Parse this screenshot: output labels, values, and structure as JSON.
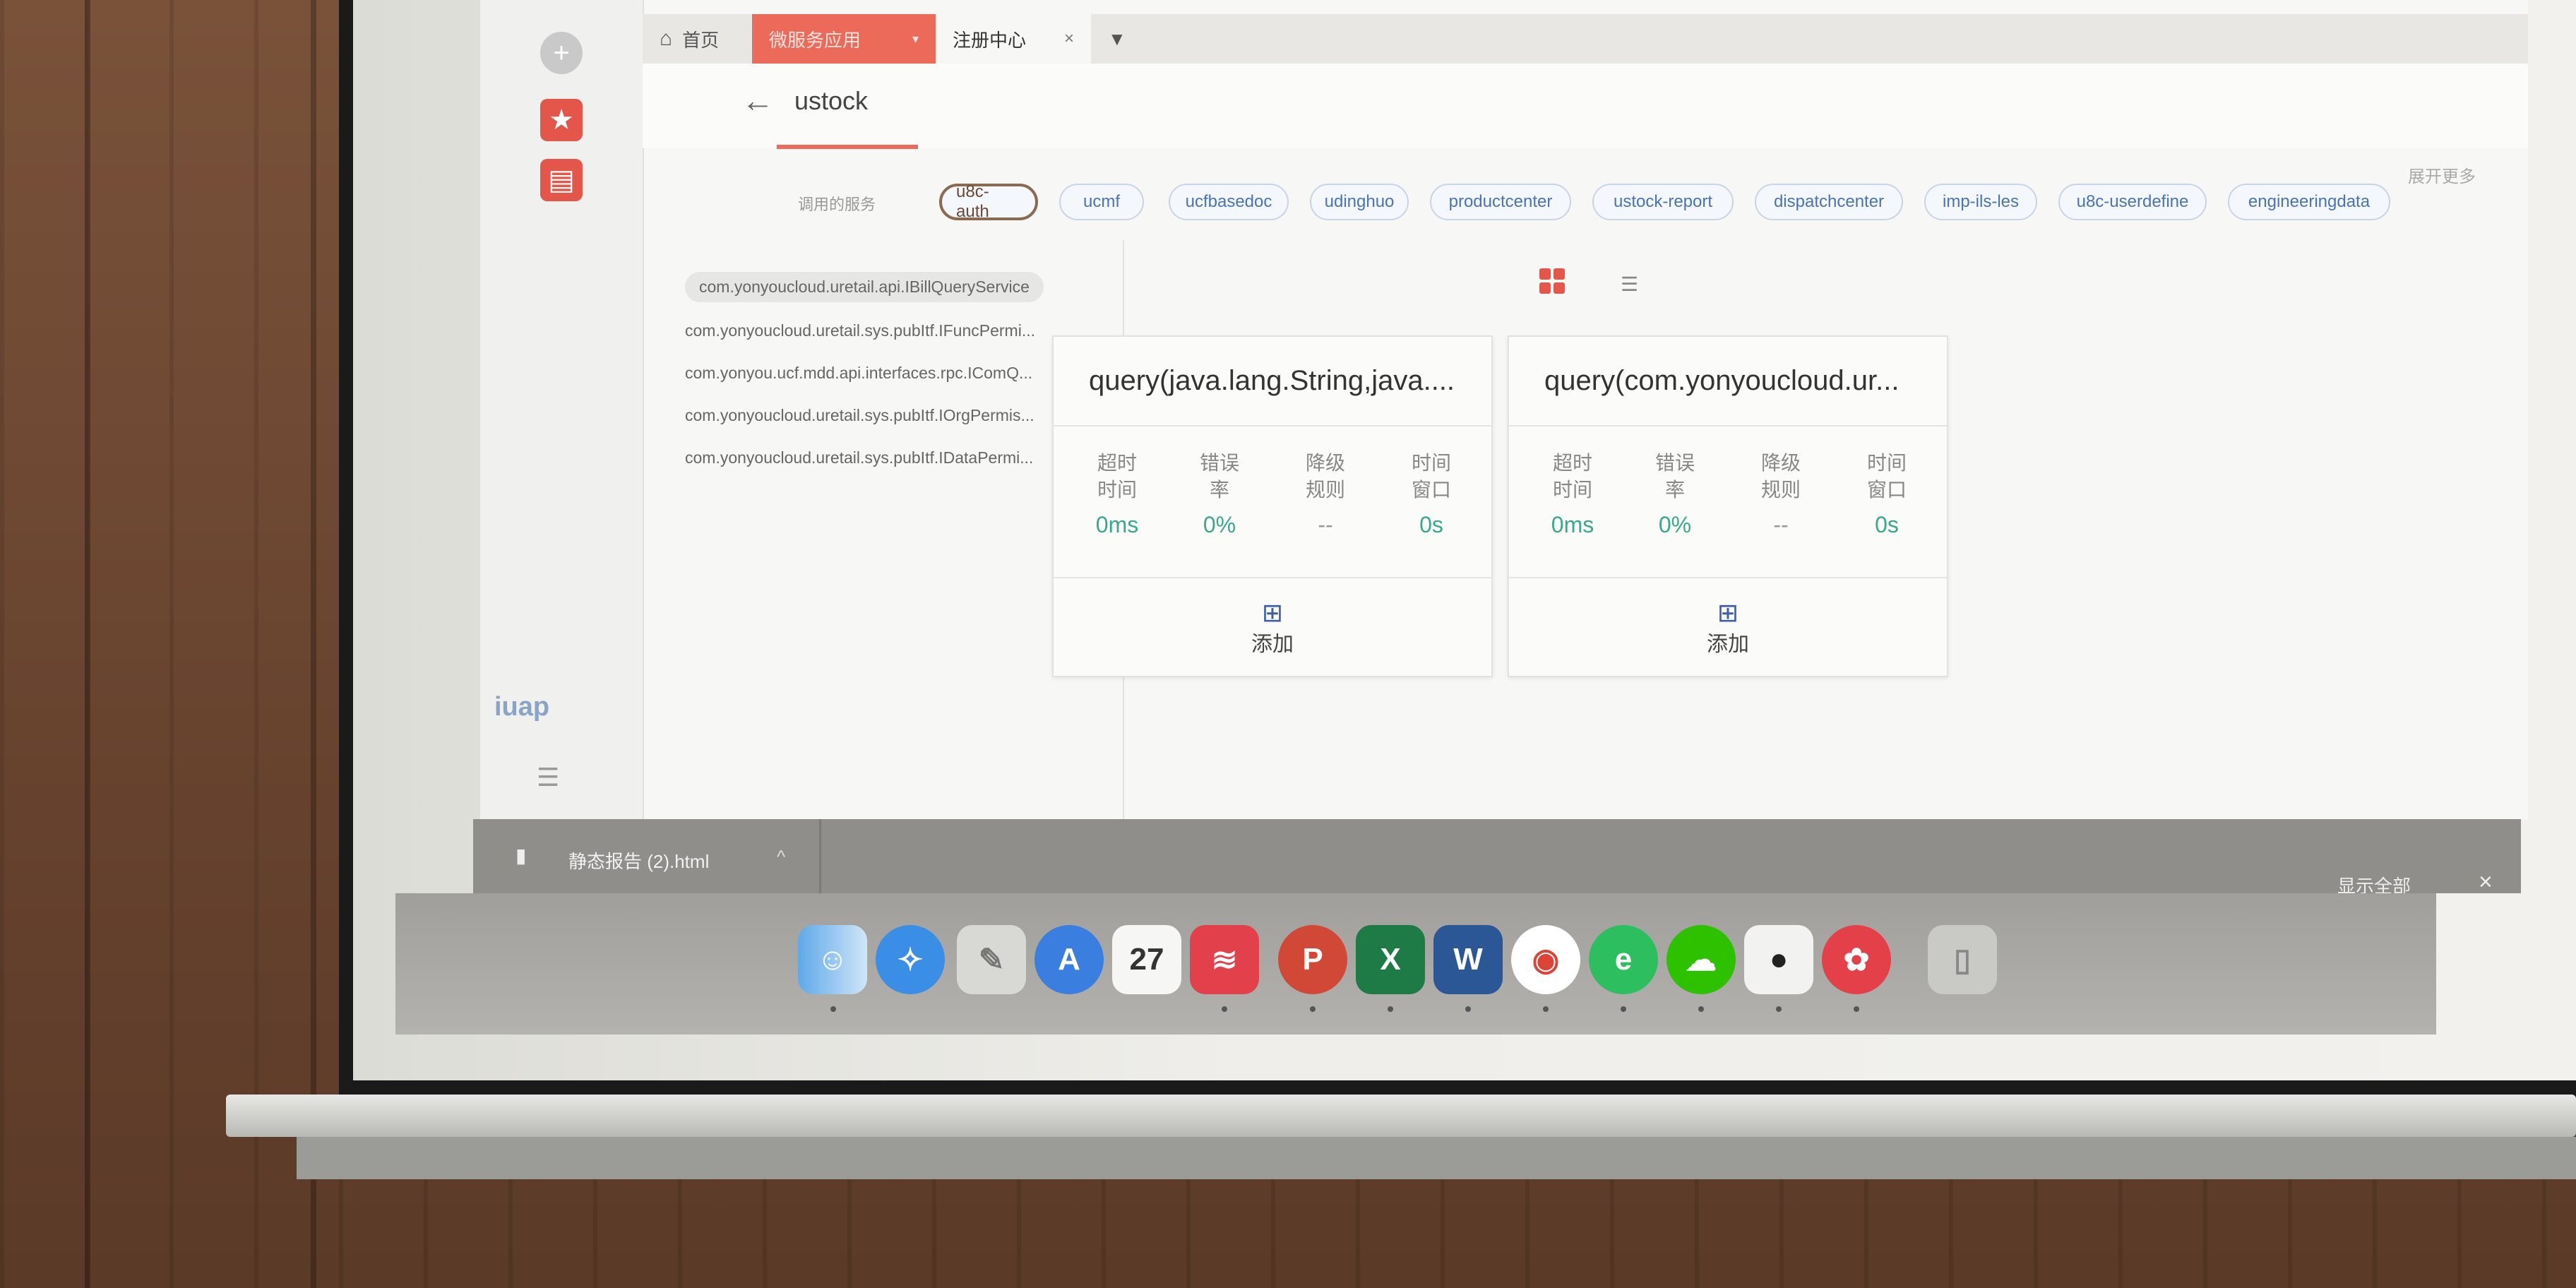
{
  "tabs": {
    "home": "首页",
    "micro": "微服务应用",
    "register": "注册中心"
  },
  "header": {
    "title": "ustock"
  },
  "services": {
    "label": "调用的服务",
    "items": [
      "u8c-auth",
      "ucmf",
      "ucfbasedoc",
      "udinghuo",
      "productcenter",
      "ustock-report",
      "dispatchcenter",
      "imp-ils-les",
      "u8c-userdefine",
      "engineeringdata"
    ],
    "more": "展开更多"
  },
  "interfaces": [
    "com.yonyoucloud.uretail.api.IBillQueryService",
    "com.yonyoucloud.uretail.sys.pubItf.IFuncPermi...",
    "com.yonyou.ucf.mdd.api.interfaces.rpc.IComQ...",
    "com.yonyoucloud.uretail.sys.pubItf.IOrgPermis...",
    "com.yonyoucloud.uretail.sys.pubItf.IDataPermi..."
  ],
  "cards": [
    {
      "title": "query(java.lang.String,java....",
      "metrics": [
        {
          "label1": "超时",
          "label2": "时间",
          "value": "0ms"
        },
        {
          "label1": "错误",
          "label2": "率",
          "value": "0%"
        },
        {
          "label1": "降级",
          "label2": "规则",
          "value": "--"
        },
        {
          "label1": "时间",
          "label2": "窗口",
          "value": "0s"
        }
      ],
      "add": "添加"
    },
    {
      "title": "query(com.yonyoucloud.ur...",
      "metrics": [
        {
          "label1": "超时",
          "label2": "时间",
          "value": "0ms"
        },
        {
          "label1": "错误",
          "label2": "率",
          "value": "0%"
        },
        {
          "label1": "降级",
          "label2": "规则",
          "value": "--"
        },
        {
          "label1": "时间",
          "label2": "窗口",
          "value": "0s"
        }
      ],
      "add": "添加"
    }
  ],
  "download": {
    "file": "静态报告 (2).html",
    "show_all": "显示全部"
  },
  "sidebar": {
    "logo": "iuap"
  },
  "dock": {
    "calendar_day": "27"
  },
  "colors": {
    "accent": "#ec6a5a",
    "link": "#4a73b8",
    "metric": "#3aa88a"
  }
}
